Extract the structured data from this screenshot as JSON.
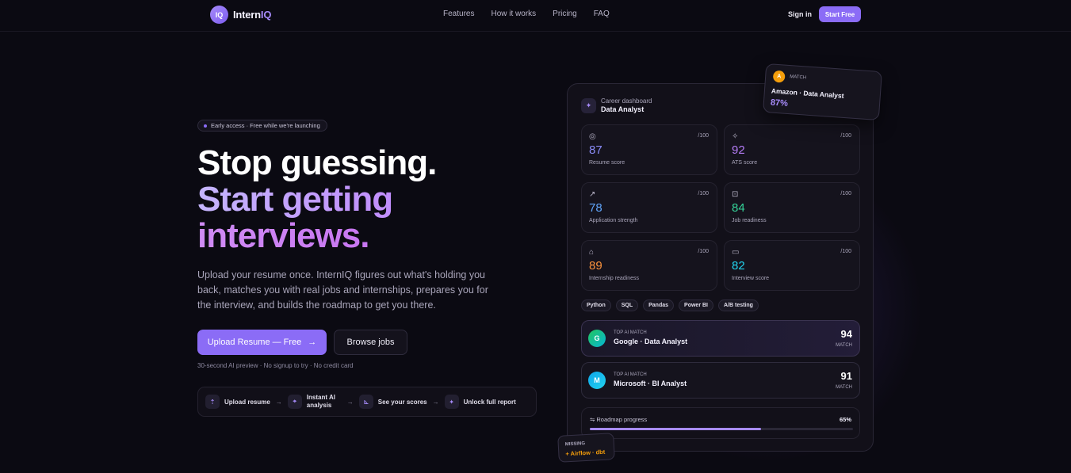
{
  "nav": {
    "logo_mark": "IQ",
    "logo_text_a": "Intern",
    "logo_text_b": "IQ",
    "links": [
      "Features",
      "How it works",
      "Pricing",
      "FAQ"
    ],
    "signin": "Sign in",
    "start_free": "Start Free"
  },
  "hero": {
    "badge": "Early access · Free while we're launching",
    "h1_line1": "Stop guessing.",
    "h1_line2": "Start getting",
    "h1_line3": "interviews.",
    "sub": "Upload your resume once. InternIQ figures out what's holding you back, matches you with real jobs and internships, prepares you for the interview, and builds the roadmap to get you there.",
    "cta_primary": "Upload Resume — Free",
    "cta_primary_arrow": "→",
    "cta_secondary": "Browse jobs",
    "fineprint": "30-second AI preview · No signup to try · No credit card",
    "steps": [
      {
        "label": "Upload resume",
        "icon": "upload-icon",
        "glyph": "⇡"
      },
      {
        "label": "Instant AI analysis",
        "icon": "scan-icon",
        "glyph": "⌖"
      },
      {
        "label": "See your scores",
        "icon": "chart-icon",
        "glyph": "⊾"
      },
      {
        "label": "Unlock full report",
        "icon": "sparkle-icon",
        "glyph": "✦"
      }
    ],
    "step_arrow": "→"
  },
  "dashboard": {
    "kicker": "Career dashboard",
    "title": "Data Analyst",
    "max": "/100",
    "scores": [
      {
        "label": "Resume score",
        "value": "87",
        "color": "#8b8cf8",
        "icon": "target-icon",
        "glyph": "◎"
      },
      {
        "label": "ATS score",
        "value": "92",
        "color": "#b47cf5",
        "icon": "sparkle-icon",
        "glyph": "✧"
      },
      {
        "label": "Application strength",
        "value": "78",
        "color": "#60a5fa",
        "icon": "trend-icon",
        "glyph": "↗"
      },
      {
        "label": "Job readiness",
        "value": "84",
        "color": "#34d399",
        "icon": "briefcase-icon",
        "glyph": "⊡"
      },
      {
        "label": "Internship readiness",
        "value": "89",
        "color": "#fb923c",
        "icon": "graduation-icon",
        "glyph": "⌂"
      },
      {
        "label": "Interview score",
        "value": "82",
        "color": "#22d3ee",
        "icon": "chat-icon",
        "glyph": "▭"
      }
    ],
    "tags": [
      "Python",
      "SQL",
      "Pandas",
      "Power BI",
      "A/B testing"
    ],
    "matches": [
      {
        "kicker": "TOP AI MATCH",
        "name": "Google · Data Analyst",
        "score": "94",
        "score_label": "MATCH",
        "logo": "G",
        "logo_color": "#14b8a6"
      },
      {
        "kicker": "TOP AI MATCH",
        "name": "Microsoft · BI Analyst",
        "score": "91",
        "score_label": "MATCH",
        "logo": "M",
        "logo_color": "#06b6d4"
      }
    ],
    "roadmap_label": "Roadmap progress",
    "roadmap_pct": "65%",
    "roadmap_fraction": 0.65
  },
  "float_match": {
    "logo": "A",
    "kicker": "MATCH",
    "name": "Amazon · Data Analyst",
    "pct": "87%"
  },
  "float_missing": {
    "kicker": "MISSING",
    "value": "+ Airflow · dbt"
  }
}
